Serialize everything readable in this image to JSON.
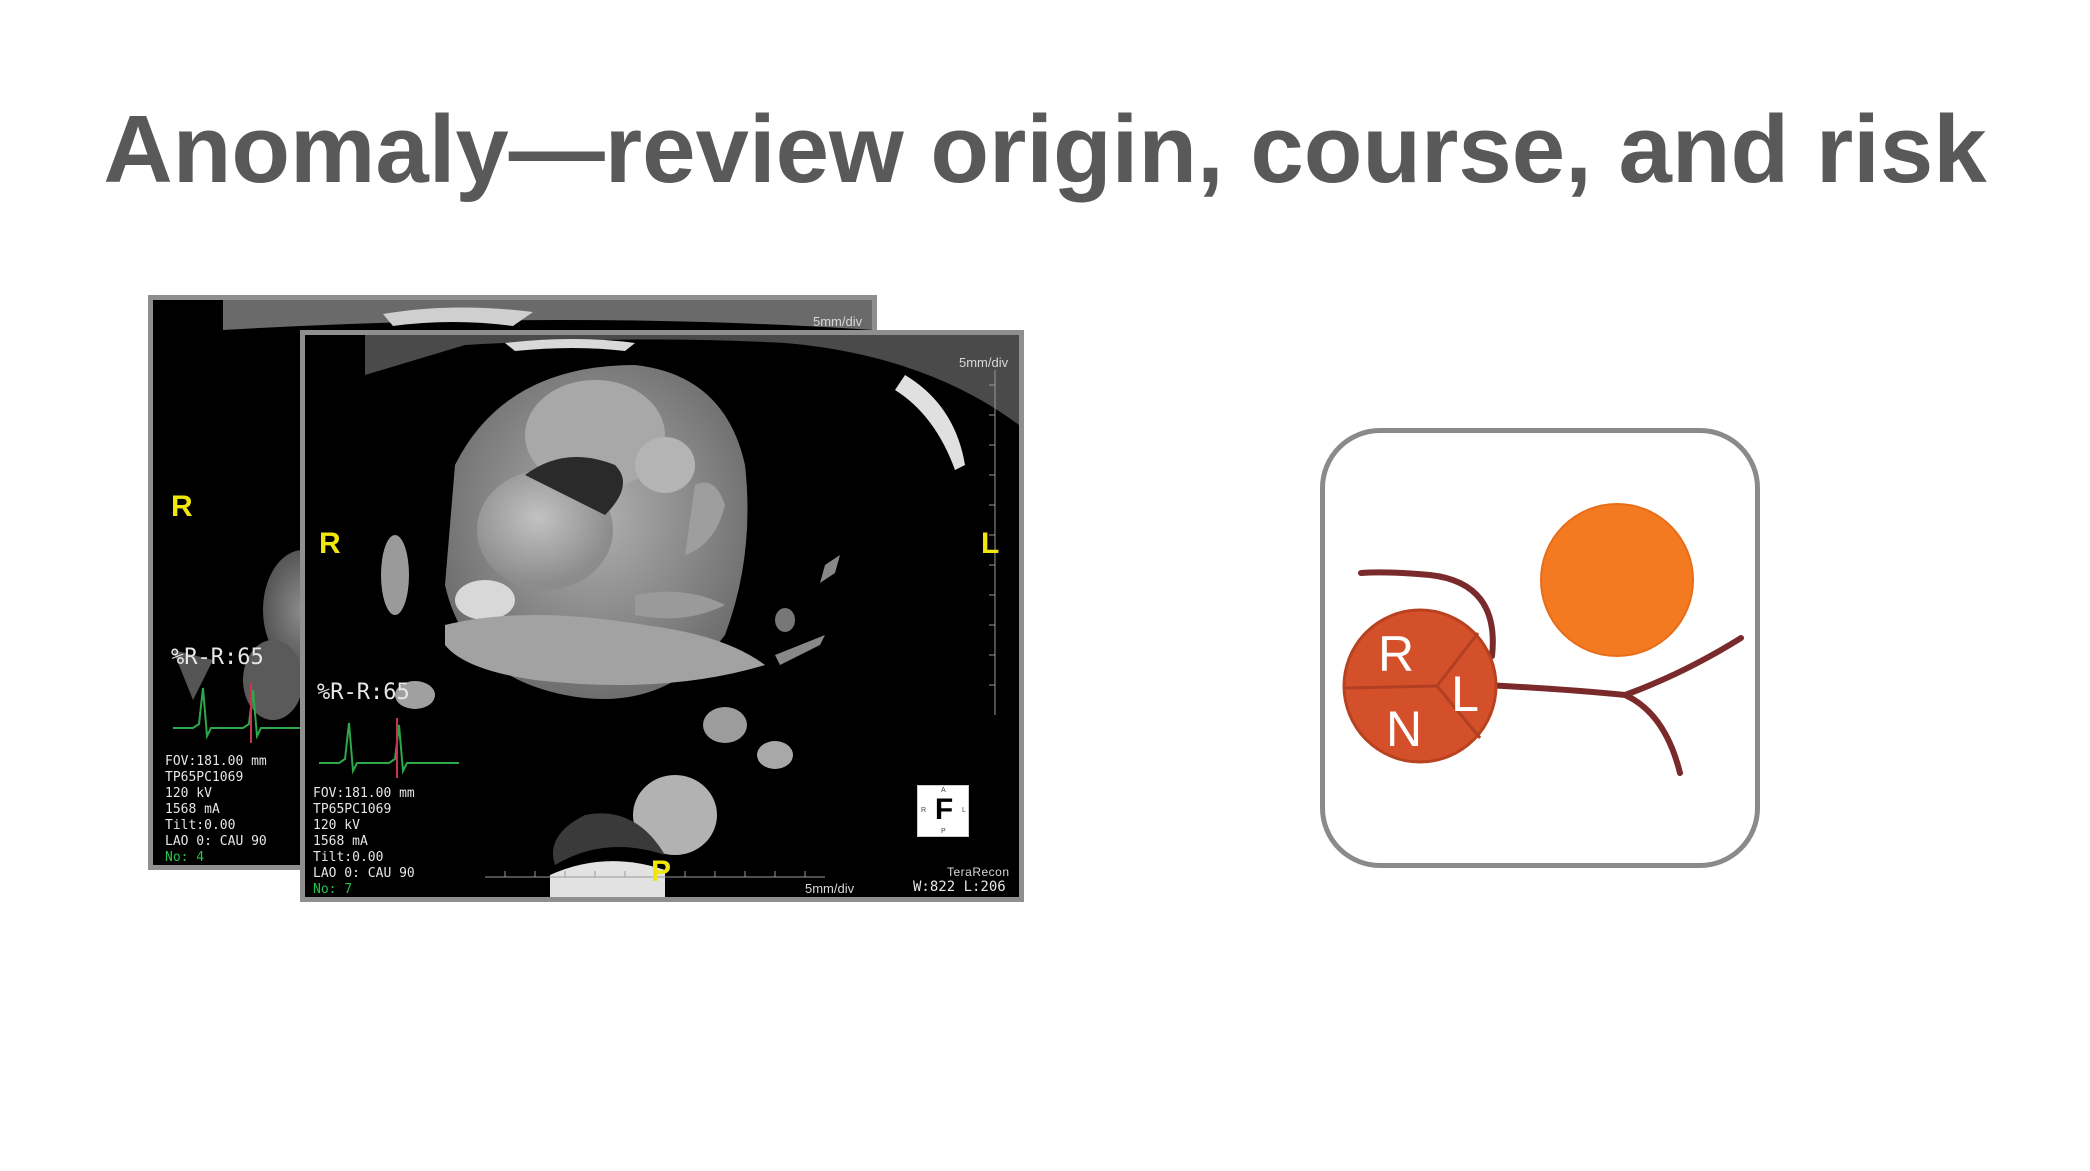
{
  "slide": {
    "title": "Anomaly—review origin, course, and risk"
  },
  "ct_back": {
    "orientation_left": "R",
    "scale_top": "5mm/div",
    "rr": "%R-R:65",
    "info": [
      "FOV:181.00 mm",
      "TP65PC1069",
      "120 kV",
      "1568 mA",
      "Tilt:0.00",
      "LAO 0: CAU 90"
    ],
    "slice": "No: 4"
  },
  "ct_front": {
    "orientation_left": "R",
    "orientation_right": "L",
    "orientation_bottom": "P",
    "scale_top": "5mm/div",
    "scale_bottom": "5mm/div",
    "rr": "%R-R:65",
    "info": [
      "FOV:181.00 mm",
      "TP65PC1069",
      "120 kV",
      "1568 mA",
      "Tilt:0.00",
      "LAO 0: CAU 90"
    ],
    "slice": "No: 7",
    "vendor": "TeraRecon",
    "window_level": "W:822 L:206",
    "cube": {
      "face": "F",
      "top": "A",
      "bottom": "P",
      "left": "R",
      "right": "L"
    }
  },
  "diagram": {
    "cusps": [
      "R",
      "L",
      "N"
    ],
    "colors": {
      "valve": "#d4502a",
      "valve_line": "#b13f22",
      "vessel": "#7a2a2a",
      "pulmonary": "#f47a22",
      "card_border": "#8a8a8a"
    }
  }
}
